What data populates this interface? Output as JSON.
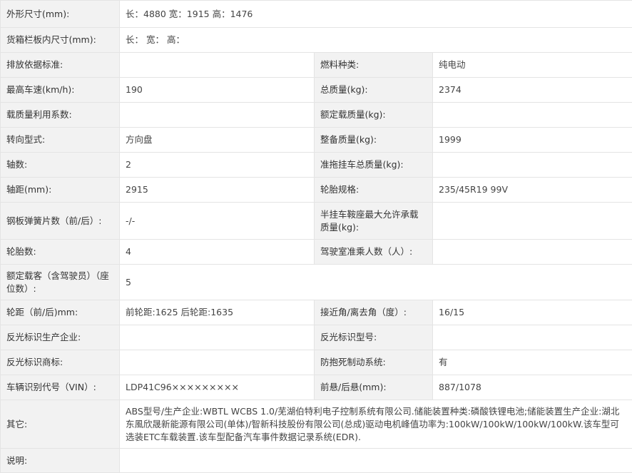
{
  "rows": [
    {
      "cells": [
        {
          "t": "外形尺寸(mm):",
          "cls": "lbl"
        },
        {
          "t": "长：4880 宽：1915 高：1476",
          "cls": "val",
          "colspan": 3
        }
      ],
      "h": 38
    },
    {
      "cells": [
        {
          "t": "货箱栏板内尺寸(mm):",
          "cls": "lbl"
        },
        {
          "t": "长： 宽： 高：",
          "cls": "val",
          "colspan": 3
        }
      ],
      "h": 35
    },
    {
      "cells": [
        {
          "t": "排放依据标准:",
          "cls": "lbl"
        },
        {
          "t": "",
          "cls": "val"
        },
        {
          "t": "燃料种类:",
          "cls": "lbl"
        },
        {
          "t": "纯电动",
          "cls": "val"
        }
      ],
      "h": 35
    },
    {
      "cells": [
        {
          "t": "最高车速(km/h):",
          "cls": "lbl"
        },
        {
          "t": "190",
          "cls": "val"
        },
        {
          "t": "总质量(kg):",
          "cls": "lbl"
        },
        {
          "t": "2374",
          "cls": "val"
        }
      ],
      "h": 35
    },
    {
      "cells": [
        {
          "t": "载质量利用系数:",
          "cls": "lbl"
        },
        {
          "t": "",
          "cls": "val"
        },
        {
          "t": "额定载质量(kg):",
          "cls": "lbl"
        },
        {
          "t": "",
          "cls": "val"
        }
      ],
      "h": 35
    },
    {
      "cells": [
        {
          "t": "转向型式:",
          "cls": "lbl"
        },
        {
          "t": "方向盘",
          "cls": "val"
        },
        {
          "t": "整备质量(kg):",
          "cls": "lbl"
        },
        {
          "t": "1999",
          "cls": "val"
        }
      ],
      "h": 35
    },
    {
      "cells": [
        {
          "t": "轴数:",
          "cls": "lbl"
        },
        {
          "t": "2",
          "cls": "val"
        },
        {
          "t": "准拖挂车总质量(kg):",
          "cls": "lbl"
        },
        {
          "t": "",
          "cls": "val"
        }
      ],
      "h": 35
    },
    {
      "cells": [
        {
          "t": "轴距(mm):",
          "cls": "lbl"
        },
        {
          "t": "2915",
          "cls": "val"
        },
        {
          "t": "轮胎规格:",
          "cls": "lbl"
        },
        {
          "t": "235/45R19 99V",
          "cls": "val"
        }
      ],
      "h": 35
    },
    {
      "cells": [
        {
          "t": "钢板弹簧片数（前/后）:",
          "cls": "lbl"
        },
        {
          "t": "-/-",
          "cls": "val"
        },
        {
          "t": "半挂车鞍座最大允许承载质量(kg):",
          "cls": "lbl"
        },
        {
          "t": "",
          "cls": "val"
        }
      ],
      "h": 52
    },
    {
      "cells": [
        {
          "t": "轮胎数:",
          "cls": "lbl"
        },
        {
          "t": "4",
          "cls": "val"
        },
        {
          "t": "驾驶室准乘人数（人）:",
          "cls": "lbl"
        },
        {
          "t": "",
          "cls": "val"
        }
      ],
      "h": 35
    },
    {
      "cells": [
        {
          "t": "额定载客（含驾驶员）（座位数）:",
          "cls": "lbl"
        },
        {
          "t": "5",
          "cls": "val",
          "colspan": 3
        }
      ],
      "h": 50
    },
    {
      "cells": [
        {
          "t": "轮距（前/后)mm:",
          "cls": "lbl"
        },
        {
          "t": "前轮距:1625 后轮距:1635",
          "cls": "val"
        },
        {
          "t": "接近角/离去角（度）:",
          "cls": "lbl"
        },
        {
          "t": "16/15",
          "cls": "val"
        }
      ],
      "h": 35
    },
    {
      "cells": [
        {
          "t": "反光标识生产企业:",
          "cls": "lbl"
        },
        {
          "t": "",
          "cls": "val"
        },
        {
          "t": "反光标识型号:",
          "cls": "lbl"
        },
        {
          "t": "",
          "cls": "val"
        }
      ],
      "h": 35
    },
    {
      "cells": [
        {
          "t": "反光标识商标:",
          "cls": "lbl"
        },
        {
          "t": "",
          "cls": "val"
        },
        {
          "t": "防抱死制动系统:",
          "cls": "lbl"
        },
        {
          "t": "有",
          "cls": "val"
        }
      ],
      "h": 35
    },
    {
      "cells": [
        {
          "t": "车辆识别代号（VIN）:",
          "cls": "lbl"
        },
        {
          "t": "LDP41C96×××××××××",
          "cls": "val"
        },
        {
          "t": "前悬/后悬(mm):",
          "cls": "lbl"
        },
        {
          "t": "887/1078",
          "cls": "val"
        }
      ],
      "h": 35
    },
    {
      "cells": [
        {
          "t": "其它:",
          "cls": "lbl"
        },
        {
          "t": "ABS型号/生产企业:WBTL WCBS 1.0/芜湖伯特利电子控制系统有限公司.储能装置种类:磷酸铁锂电池;储能装置生产企业:湖北东風欣晟新能源有限公司(单体)/智新科技股份有限公司(总成)驱动电机峰值功率为:100kW/100kW/100kW/100kW.该车型可选装ETC车载装置.该车型配备汽车事件数据记录系统(EDR).",
          "cls": "val",
          "colspan": 3
        }
      ],
      "h": 68
    },
    {
      "cells": [
        {
          "t": "说明:",
          "cls": "lbl"
        },
        {
          "t": "",
          "cls": "val",
          "colspan": 3
        }
      ],
      "h": 34
    }
  ]
}
